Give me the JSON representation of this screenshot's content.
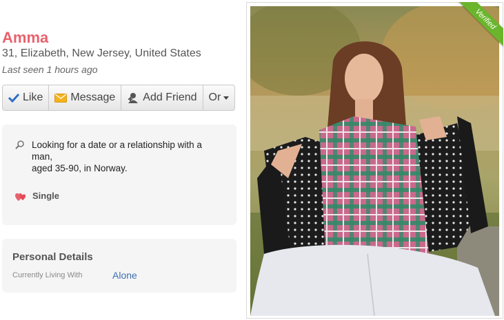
{
  "profile": {
    "name": "Amma",
    "location": "31, Elizabeth, New Jersey, United States",
    "last_seen": "Last seen 1 hours ago"
  },
  "actions": {
    "like": "Like",
    "message": "Message",
    "add_friend": "Add Friend",
    "or": "Or"
  },
  "about": {
    "looking_line1": "Looking for a date or a relationship with a",
    "looking_line2": "man,",
    "looking_line3": "aged 35-90, in Norway.",
    "status": "Single"
  },
  "personal_details": {
    "title": "Personal Details",
    "label": "Currently Living With",
    "value": "Alone"
  },
  "photo": {
    "badge": "Verified"
  },
  "colors": {
    "name": "#e8626d",
    "link": "#3a6fb0",
    "verified": "#6ab52c"
  },
  "icons": [
    "checkmark-icon",
    "envelope-icon",
    "add-user-icon",
    "caret-down-icon",
    "search-icon",
    "hearts-icon"
  ]
}
